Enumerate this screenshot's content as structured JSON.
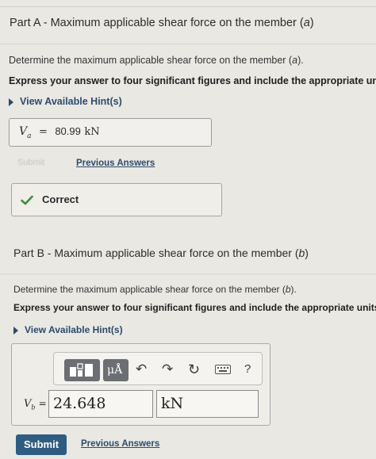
{
  "part_a": {
    "header_prefix": "Part A - Maximum applicable shear force on the member (",
    "header_var": "a",
    "header_suffix": ")",
    "question_prefix": "Determine the maximum applicable shear force on the member (",
    "question_var": "a",
    "question_suffix": ").",
    "instruction": "Express your answer to four significant figures and include the appropriate units.",
    "hint_label": "View Available Hint(s)",
    "answer_symbol": "V",
    "answer_subscript": "a",
    "answer_equals": "=",
    "answer_value": "80.99",
    "answer_unit": "kN",
    "submit_label": "Submit",
    "previous_answers_label": "Previous Answers",
    "result_label": "Correct"
  },
  "part_b": {
    "header_prefix": "Part B - Maximum applicable shear force on the member (",
    "header_var": "b",
    "header_suffix": ")",
    "question_prefix": "Determine the maximum applicable shear force on the member (",
    "question_var": "b",
    "question_suffix": ").",
    "instruction": "Express your answer to four significant figures and include the appropriate units.",
    "hint_label": "View Available Hint(s)",
    "toolbar": {
      "templates_icon": "templates-icon",
      "units_button_label": "μÅ",
      "undo_icon": "↶",
      "redo_icon": "↷",
      "reset_icon": "↻",
      "keyboard_icon": "keyboard-icon",
      "help_label": "?"
    },
    "input_symbol": "V",
    "input_subscript": "b",
    "input_equals": "=",
    "input_value": "24.648",
    "input_unit": "kN",
    "submit_label": "Submit",
    "previous_answers_label": "Previous Answers"
  },
  "colors": {
    "background": "#e9e8e3",
    "link": "#2d4a6b",
    "correct_check": "#3d8c3a",
    "submit_button": "#2f5d82",
    "toolbar_button": "#6b6f73"
  }
}
